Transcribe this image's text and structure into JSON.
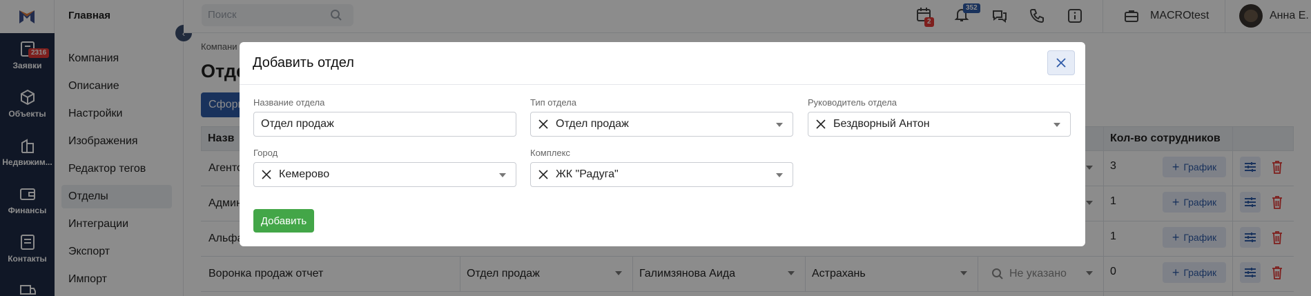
{
  "rail": {
    "items": [
      {
        "label": "Заявки",
        "badge": "2316"
      },
      {
        "label": "Объекты"
      },
      {
        "label": "Недвижим..."
      },
      {
        "label": "Финансы"
      },
      {
        "label": "Контакты"
      }
    ]
  },
  "sidebar": {
    "title": "Главная",
    "items": [
      "Компания",
      "Описание",
      "Настройки",
      "Изображения",
      "Редактор тегов",
      "Отделы",
      "Интеграции",
      "Экспорт",
      "Импорт"
    ],
    "active": "Отделы"
  },
  "header": {
    "search_placeholder": "Поиск",
    "calendar_badge": "2",
    "bell_badge": "352",
    "account_name": "MACROtest",
    "user_name": "Анна Е."
  },
  "page": {
    "breadcrumb": "Компани",
    "title": "Отде",
    "form_button": "Сформ",
    "columns": {
      "name": "Назв",
      "employees": "Кол-во сотрудников"
    },
    "rows": [
      {
        "name": "Агенто",
        "count": "3",
        "graph": "График"
      },
      {
        "name": "Админ",
        "count": "1",
        "graph": "График"
      },
      {
        "name": "Альфа",
        "count": "1",
        "graph": "График"
      },
      {
        "name": "Воронка продаж отчет",
        "type": "Отдел продаж",
        "head": "Галимзянова Аида",
        "city": "Астрахань",
        "complex": "Не указано",
        "count": "0",
        "graph": "График"
      }
    ]
  },
  "modal": {
    "title": "Добавить отдел",
    "fields": {
      "name": {
        "label": "Название отдела",
        "value": "Отдел продаж"
      },
      "type": {
        "label": "Тип отдела",
        "value": "Отдел продаж"
      },
      "head": {
        "label": "Руководитель отдела",
        "value": "Бездворный Антон"
      },
      "city": {
        "label": "Город",
        "value": "Кемерово"
      },
      "complex": {
        "label": "Комплекс",
        "value": "ЖК \"Радуга\""
      }
    },
    "submit_label": "Добавить"
  },
  "colors": {
    "rail": "#1e2a46",
    "primary": "#2f5ba8",
    "success": "#43a648",
    "danger": "#e53935"
  }
}
